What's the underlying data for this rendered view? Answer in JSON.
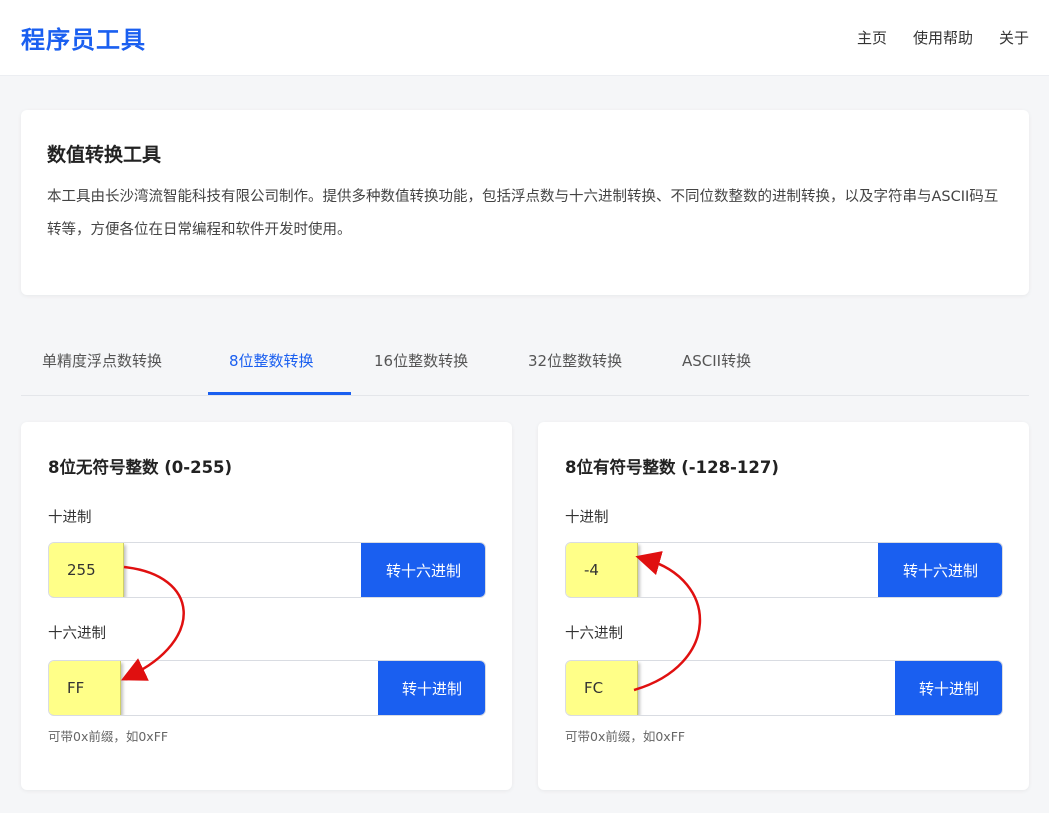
{
  "header": {
    "brand": "程序员工具",
    "nav": [
      "主页",
      "使用帮助",
      "关于"
    ]
  },
  "intro": {
    "title": "数值转换工具",
    "description": "本工具由长沙湾流智能科技有限公司制作。提供多种数值转换功能，包括浮点数与十六进制转换、不同位数整数的进制转换，以及字符串与ASCII码互转等，方便各位在日常编程和软件开发时使用。"
  },
  "tabs": [
    {
      "label": "单精度浮点数转换",
      "active": false
    },
    {
      "label": "8位整数转换",
      "active": true
    },
    {
      "label": "16位整数转换",
      "active": false
    },
    {
      "label": "32位整数转换",
      "active": false
    },
    {
      "label": "ASCII转换",
      "active": false
    }
  ],
  "unsigned": {
    "title": "8位无符号整数 (0-255)",
    "decimal_label": "十进制",
    "decimal_value": "255",
    "to_hex_button": "转十六进制",
    "hex_label": "十六进制",
    "hex_value": "FF",
    "to_dec_button": "转十进制",
    "hint": "可带0x前缀，如0xFF"
  },
  "signed": {
    "title": "8位有符号整数 (-128-127)",
    "decimal_label": "十进制",
    "decimal_value": "-4",
    "to_hex_button": "转十六进制",
    "hex_label": "十六进制",
    "hex_value": "FC",
    "to_dec_button": "转十进制",
    "hint": "可带0x前缀，如0xFF"
  },
  "colors": {
    "accent": "#1a5ff0",
    "highlight": "#ffff88",
    "annotation_arrow": "#e01010"
  }
}
